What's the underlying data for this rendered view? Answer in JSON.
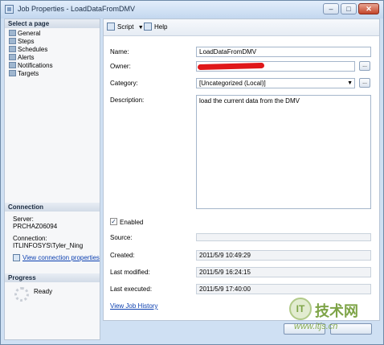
{
  "window": {
    "title": "Job Properties - LoadDataFromDMV",
    "buttons": {
      "minimize": "–",
      "maximize": "□",
      "close": "✕"
    }
  },
  "left_panel": {
    "select_page_header": "Select a page",
    "pages": [
      "General",
      "Steps",
      "Schedules",
      "Alerts",
      "Notifications",
      "Targets"
    ],
    "connection_header": "Connection",
    "server_label": "Server:",
    "server_value": "PRCHAZ06094",
    "connection_label": "Connection:",
    "connection_value": "ITLINFOSYS\\Tyler_Ning",
    "view_connection_link": "View connection properties",
    "progress_header": "Progress",
    "progress_status": "Ready"
  },
  "toolbar": {
    "script_label": "Script",
    "help_label": "Help"
  },
  "form": {
    "name_label": "Name:",
    "name_value": "LoadDataFromDMV",
    "owner_label": "Owner:",
    "category_label": "Category:",
    "category_value": "[Uncategorized (Local)]",
    "description_label": "Description:",
    "description_value": "load the current data from the DMV",
    "enabled_label": "Enabled",
    "enabled_checked": true,
    "source_label": "Source:",
    "source_value": "",
    "created_label": "Created:",
    "created_value": "2011/5/9 10:49:29",
    "last_modified_label": "Last modified:",
    "last_modified_value": "2011/5/9 16:24:15",
    "last_executed_label": "Last executed:",
    "last_executed_value": "2011/5/9 17:40:00",
    "view_history_link": "View Job History",
    "browse_button": "..."
  },
  "watermark": {
    "logo_text": "IT",
    "brand": "技术网",
    "url": "www.itjs.cn"
  }
}
